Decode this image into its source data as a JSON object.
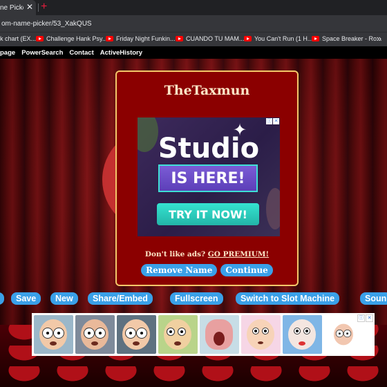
{
  "browser": {
    "tab_title": "ne Picker",
    "tab_close_glyph": "✕",
    "new_tab_glyph": "+",
    "url": "om-name-picker/53_XakQUS",
    "bookmarks": [
      {
        "label": "k chart (EX...",
        "icon": "none"
      },
      {
        "label": "Challenge Hank Psy...",
        "icon": "youtube-icon"
      },
      {
        "label": "Friday Night Funkin...",
        "icon": "youtube-icon"
      },
      {
        "label": "CUANDO TU MAM...",
        "icon": "youtube-icon"
      },
      {
        "label": "You Can't Run (1 H...",
        "icon": "youtube-icon"
      },
      {
        "label": "Space Breaker - Ro...",
        "icon": "youtube-icon"
      }
    ],
    "bookmarks_more": "»"
  },
  "site_nav": [
    "page",
    "PowerSearch",
    "Contact",
    "ActiveHistory"
  ],
  "modal": {
    "title": "TheTaxmun",
    "ad": {
      "headline": "Studio",
      "banner": "IS HERE!",
      "cta": "TRY IT NOW!",
      "info_glyph": "ⓘ",
      "close_glyph": "✕"
    },
    "dislike_text": "Don't like ads?",
    "premium_link": "GO PREMIUM!",
    "buttons": {
      "remove_name": "Remove Name",
      "continue": "Continue"
    }
  },
  "toolbar": {
    "partial_left": "",
    "save": "Save",
    "new": "New",
    "share": "Share/Embed",
    "fullscreen": "Fullscreen",
    "slot": "Switch to Slot Machine",
    "sound": "Soun"
  },
  "ad_strip": {
    "info_glyph": "ⓘ",
    "close_glyph": "✕",
    "thumbnail_count": 8
  },
  "colors": {
    "modal_bg": "#8b0000",
    "modal_border": "#f4c86a",
    "button_blue": "#3aa0e8",
    "title_text": "#fde6c7"
  }
}
